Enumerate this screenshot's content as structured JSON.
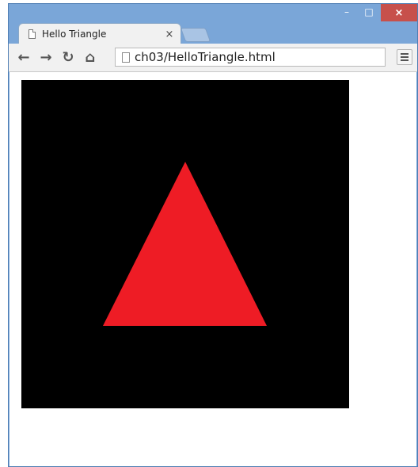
{
  "window": {
    "controls": {
      "minimize": "–",
      "maximize": "□",
      "close": "×"
    }
  },
  "tab": {
    "title": "Hello Triangle",
    "close": "×"
  },
  "toolbar": {
    "back_icon": "←",
    "forward_icon": "→",
    "reload_icon": "↻",
    "home_icon": "⌂",
    "url": "ch03/HelloTriangle.html"
  },
  "canvas": {
    "background": "#000000",
    "triangle_color": "#ee1c25"
  }
}
